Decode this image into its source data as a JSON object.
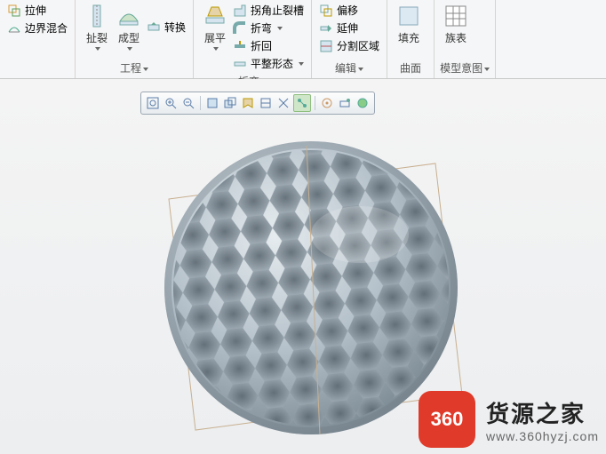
{
  "ribbon": {
    "left": {
      "item1": "拉伸",
      "item2": "边界混合"
    },
    "g1": {
      "big1": "扯裂",
      "big2": "成型",
      "small": "转换",
      "label": "工程"
    },
    "g2": {
      "s1": "拐角止裂槽",
      "s2": "展平",
      "s3": "平整形态",
      "big1": "折弯",
      "big2": "折回",
      "label": "折弯"
    },
    "g3": {
      "s1": "偏移",
      "s2": "延伸",
      "big": "分割区域",
      "label": "编辑"
    },
    "g4": {
      "big": "填充",
      "label": "曲面"
    },
    "g5": {
      "big": "族表",
      "label": "模型意图"
    }
  },
  "watermark": {
    "logo": "360",
    "cn": "货源之家",
    "url": "www.360hyzj.com"
  },
  "icons": {
    "stretch": "拉伸",
    "boundary": "边界",
    "rip": "扯裂",
    "form": "成型",
    "convert": "转换",
    "corner": "拐角",
    "flatten": "展平",
    "flatform": "平整",
    "bend": "折弯",
    "bendback": "折回",
    "offset": "偏移",
    "extend": "延伸",
    "split": "分割",
    "fill": "填充",
    "family": "族表",
    "zoom-fit": "zf",
    "zoom-in": "zi",
    "zoom-out": "zo"
  }
}
